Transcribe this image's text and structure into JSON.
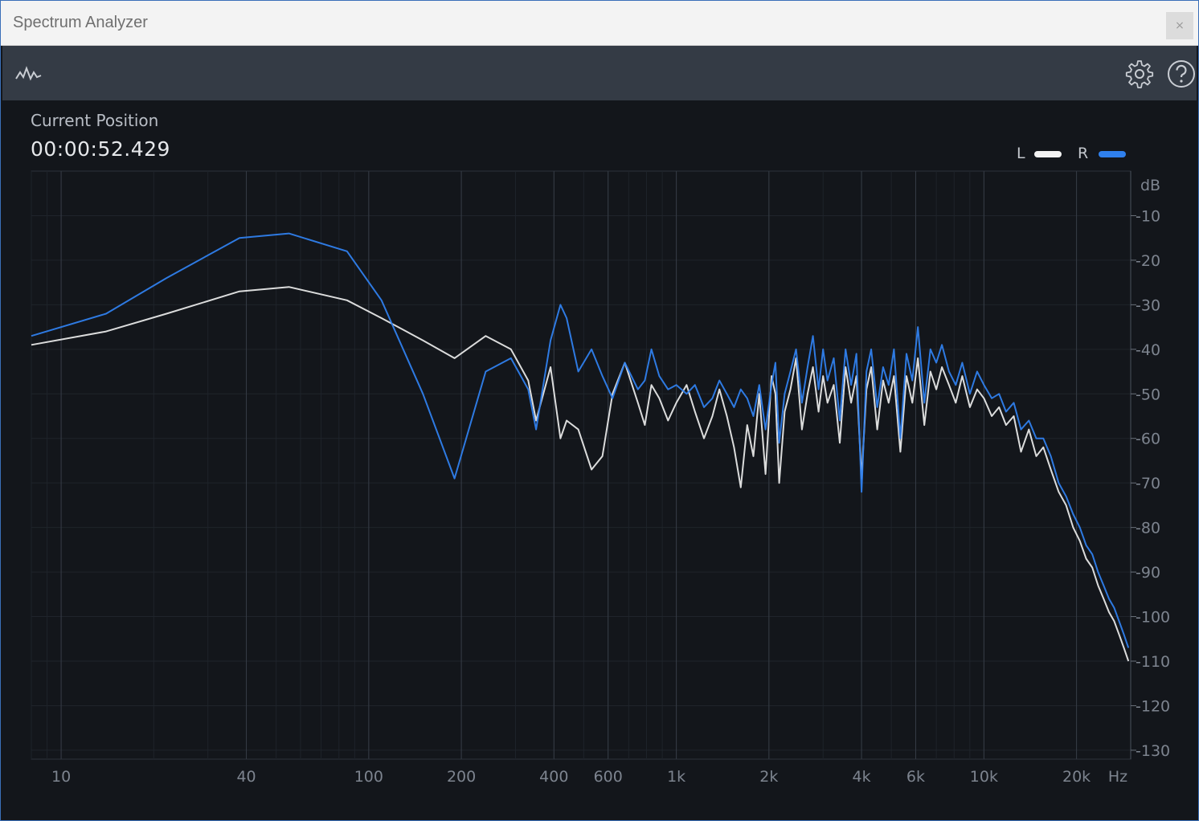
{
  "window": {
    "title": "Spectrum Analyzer",
    "close_label": "×"
  },
  "toolbar": {
    "left_icon": "spectrum-icon",
    "right_icons": [
      "gear-icon",
      "help-icon"
    ]
  },
  "position": {
    "label": "Current Position",
    "value": "00:00:52.429"
  },
  "legend": [
    {
      "label": "L",
      "color": "#f2f2f2"
    },
    {
      "label": "R",
      "color": "#2f80ed"
    }
  ],
  "chart_data": {
    "type": "line",
    "x_scale": "log",
    "xlim": [
      8,
      30000
    ],
    "ylim": [
      -132,
      0
    ],
    "xlabel": "Hz",
    "ylabel": "dB",
    "x_ticks": [
      {
        "value": 10,
        "label": "10"
      },
      {
        "value": 40,
        "label": "40"
      },
      {
        "value": 100,
        "label": "100"
      },
      {
        "value": 200,
        "label": "200"
      },
      {
        "value": 400,
        "label": "400"
      },
      {
        "value": 600,
        "label": "600"
      },
      {
        "value": 1000,
        "label": "1k"
      },
      {
        "value": 2000,
        "label": "2k"
      },
      {
        "value": 4000,
        "label": "4k"
      },
      {
        "value": 6000,
        "label": "6k"
      },
      {
        "value": 10000,
        "label": "10k"
      },
      {
        "value": 20000,
        "label": "20k"
      }
    ],
    "y_ticks": [
      {
        "value": -10,
        "label": "-10"
      },
      {
        "value": -20,
        "label": "-20"
      },
      {
        "value": -30,
        "label": "-30"
      },
      {
        "value": -40,
        "label": "-40"
      },
      {
        "value": -50,
        "label": "-50"
      },
      {
        "value": -60,
        "label": "-60"
      },
      {
        "value": -70,
        "label": "-70"
      },
      {
        "value": -80,
        "label": "-80"
      },
      {
        "value": -90,
        "label": "-90"
      },
      {
        "value": -100,
        "label": "-100"
      },
      {
        "value": -110,
        "label": "-110"
      },
      {
        "value": -120,
        "label": "-120"
      },
      {
        "value": -130,
        "label": "-130"
      }
    ],
    "grid": true,
    "series": [
      {
        "name": "L",
        "color": "#f2f2f2",
        "x": [
          8,
          14,
          22,
          38,
          55,
          85,
          110,
          150,
          190,
          240,
          290,
          330,
          350,
          390,
          420,
          440,
          480,
          530,
          575,
          620,
          680,
          750,
          790,
          830,
          880,
          940,
          1000,
          1080,
          1150,
          1230,
          1310,
          1380,
          1460,
          1540,
          1620,
          1700,
          1780,
          1860,
          1950,
          2040,
          2100,
          2160,
          2250,
          2350,
          2450,
          2560,
          2670,
          2780,
          2900,
          3000,
          3100,
          3250,
          3400,
          3550,
          3700,
          3850,
          4000,
          4150,
          4300,
          4500,
          4700,
          4900,
          5100,
          5350,
          5600,
          5850,
          6100,
          6400,
          6700,
          7000,
          7300,
          7700,
          8100,
          8500,
          9000,
          9500,
          10000,
          10600,
          11200,
          11800,
          12500,
          13200,
          14000,
          14800,
          15600,
          16500,
          17500,
          18500,
          19500,
          20500,
          21500,
          22500,
          23500,
          24500,
          25500,
          26500,
          27500,
          28500,
          29500
        ],
        "y": [
          -39,
          -36,
          -32,
          -27,
          -26,
          -29,
          -33,
          -38,
          -42,
          -37,
          -40,
          -47,
          -56,
          -44,
          -60,
          -56,
          -58,
          -67,
          -64,
          -50,
          -43,
          -52,
          -57,
          -48,
          -51,
          -56,
          -52,
          -48,
          -54,
          -60,
          -55,
          -49,
          -55,
          -62,
          -71,
          -57,
          -64,
          -50,
          -68,
          -46,
          -50,
          -70,
          -54,
          -49,
          -42,
          -58,
          -50,
          -44,
          -54,
          -46,
          -52,
          -48,
          -61,
          -44,
          -52,
          -46,
          -69,
          -49,
          -44,
          -58,
          -47,
          -52,
          -46,
          -63,
          -46,
          -52,
          -42,
          -57,
          -45,
          -49,
          -44,
          -48,
          -52,
          -46,
          -53,
          -49,
          -51,
          -55,
          -53,
          -57,
          -55,
          -63,
          -58,
          -64,
          -62,
          -67,
          -72,
          -75,
          -80,
          -83,
          -87,
          -89,
          -93,
          -96,
          -99,
          -101,
          -104,
          -107,
          -110
        ]
      },
      {
        "name": "R",
        "color": "#2f80ed",
        "x": [
          8,
          14,
          22,
          38,
          55,
          85,
          110,
          150,
          190,
          240,
          290,
          330,
          350,
          390,
          420,
          440,
          480,
          530,
          575,
          620,
          680,
          750,
          790,
          830,
          880,
          940,
          1000,
          1080,
          1150,
          1230,
          1310,
          1380,
          1460,
          1540,
          1620,
          1700,
          1780,
          1860,
          1950,
          2040,
          2100,
          2160,
          2250,
          2350,
          2450,
          2560,
          2670,
          2780,
          2900,
          3000,
          3100,
          3250,
          3400,
          3550,
          3700,
          3850,
          4000,
          4150,
          4300,
          4500,
          4700,
          4900,
          5100,
          5350,
          5600,
          5850,
          6100,
          6400,
          6700,
          7000,
          7300,
          7700,
          8100,
          8500,
          9000,
          9500,
          10000,
          10600,
          11200,
          11800,
          12500,
          13200,
          14000,
          14800,
          15600,
          16500,
          17500,
          18500,
          19500,
          20500,
          21500,
          22500,
          23500,
          24500,
          25500,
          26500,
          27500,
          28500,
          29500
        ],
        "y": [
          -37,
          -32,
          -24,
          -15,
          -14,
          -18,
          -29,
          -50,
          -69,
          -45,
          -42,
          -49,
          -58,
          -38,
          -30,
          -33,
          -45,
          -40,
          -46,
          -51,
          -43,
          -49,
          -47,
          -40,
          -46,
          -49,
          -48,
          -50,
          -48,
          -53,
          -51,
          -47,
          -50,
          -53,
          -49,
          -51,
          -55,
          -48,
          -58,
          -48,
          -43,
          -61,
          -50,
          -45,
          -40,
          -52,
          -44,
          -37,
          -49,
          -40,
          -47,
          -42,
          -56,
          -40,
          -48,
          -41,
          -72,
          -45,
          -40,
          -53,
          -44,
          -48,
          -40,
          -60,
          -41,
          -47,
          -35,
          -52,
          -40,
          -43,
          -39,
          -45,
          -48,
          -43,
          -50,
          -45,
          -48,
          -51,
          -50,
          -54,
          -52,
          -58,
          -56,
          -60,
          -60,
          -64,
          -70,
          -73,
          -77,
          -80,
          -84,
          -86,
          -90,
          -93,
          -96,
          -98,
          -101,
          -104,
          -107
        ]
      }
    ]
  }
}
